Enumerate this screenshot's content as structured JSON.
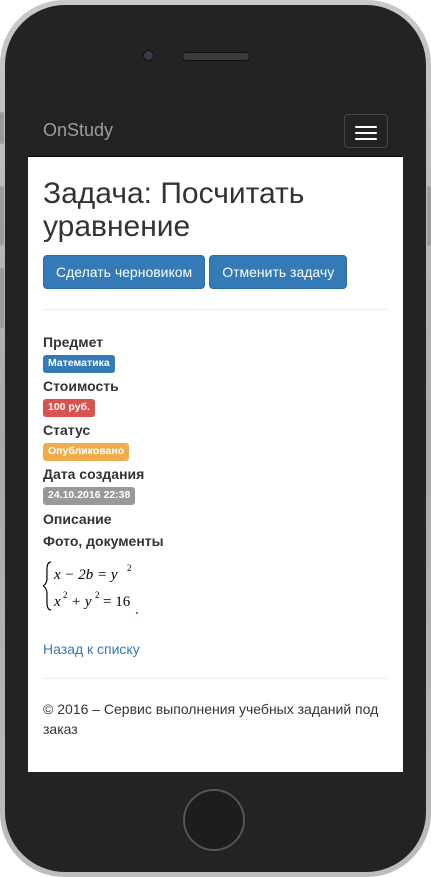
{
  "app": {
    "brand": "OnStudy"
  },
  "navbar": {
    "menu_icon": "hamburger-icon"
  },
  "task": {
    "title": "Задача: Посчитать уравнение",
    "actions": {
      "draft_label": "Сделать черновиком",
      "cancel_label": "Отменить задачу"
    }
  },
  "details": {
    "subject": {
      "label": "Предмет",
      "value": "Математика",
      "color": "#337ab7"
    },
    "cost": {
      "label": "Стоимость",
      "value": "100 руб.",
      "color": "#d9534f"
    },
    "status": {
      "label": "Статус",
      "value": "Опубликовано",
      "color": "#f0ad4e"
    },
    "created": {
      "label": "Дата создания",
      "value": "24.10.2016 22:38",
      "color": "#999999"
    },
    "description": {
      "label": "Описание"
    },
    "attachments": {
      "label": "Фото, документы"
    }
  },
  "back_link": "Назад к списку",
  "footer": {
    "text": "© 2016 – Сервис выполнения учебных заданий под заказ"
  },
  "colors": {
    "primary": "#337ab7",
    "navbar": "#222222"
  }
}
